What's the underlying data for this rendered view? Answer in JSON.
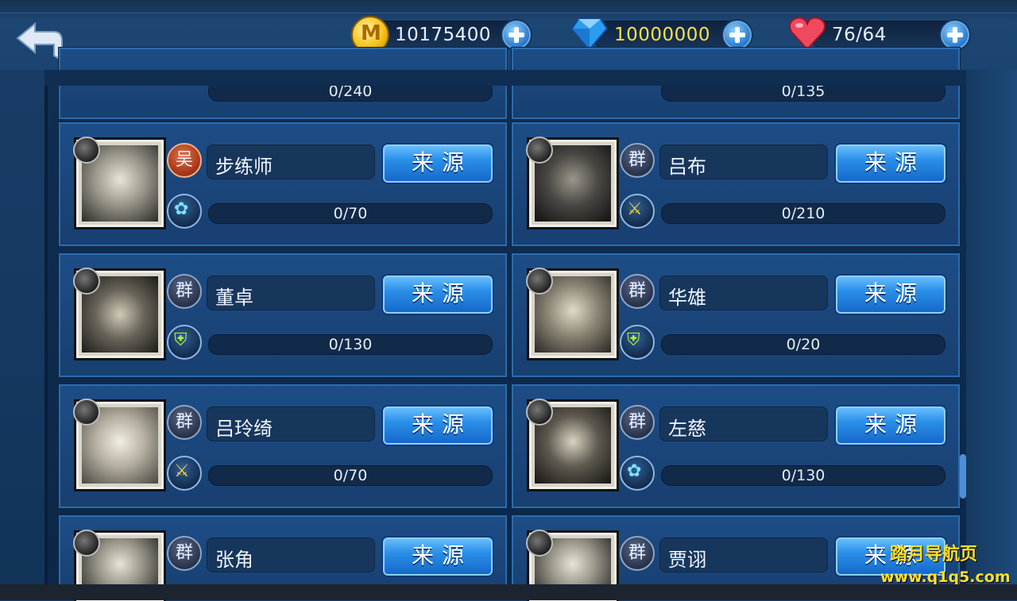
{
  "header": {
    "gold": "10175400",
    "diamonds": "10000000",
    "stamina": "76/64"
  },
  "cards_top_row_partial": [
    {
      "progress": "0/240"
    },
    {
      "progress": "0/135"
    }
  ],
  "cards": [
    {
      "faction": "吴",
      "name": "步练师",
      "role_icon": "spirit-icon",
      "progress": "0/70",
      "button": "来源"
    },
    {
      "faction": "群",
      "name": "吕布",
      "role_icon": "sword-icon",
      "progress": "0/210",
      "button": "来源"
    },
    {
      "faction": "群",
      "name": "董卓",
      "role_icon": "shield-icon",
      "progress": "0/130",
      "button": "来源"
    },
    {
      "faction": "群",
      "name": "华雄",
      "role_icon": "shield-icon",
      "progress": "0/20",
      "button": "来源"
    },
    {
      "faction": "群",
      "name": "吕玲绮",
      "role_icon": "sword-icon",
      "progress": "0/70",
      "button": "来源"
    },
    {
      "faction": "群",
      "name": "左慈",
      "role_icon": "spirit-icon",
      "progress": "0/130",
      "button": "来源"
    },
    {
      "faction": "群",
      "name": "张角",
      "role_icon": "",
      "progress": "",
      "button": "来源"
    },
    {
      "faction": "群",
      "name": "贾诩",
      "role_icon": "",
      "progress": "",
      "button": "来源"
    }
  ],
  "watermark": {
    "line1": "踏月导航页",
    "line2": "www.q1q5.com"
  }
}
